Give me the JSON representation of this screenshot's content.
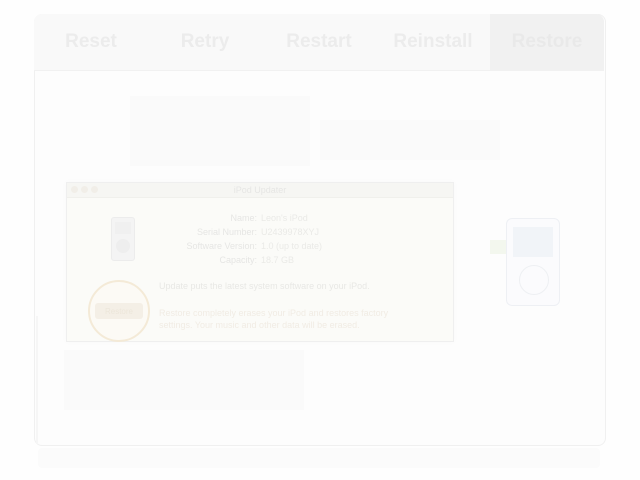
{
  "tabs": [
    {
      "label": "Reset",
      "active": false
    },
    {
      "label": "Retry",
      "active": false
    },
    {
      "label": "Restart",
      "active": false
    },
    {
      "label": "Reinstall",
      "active": false
    },
    {
      "label": "Restore",
      "active": true
    }
  ],
  "dialog": {
    "title": "iPod Updater",
    "info": [
      {
        "key": "Name:",
        "value": "Leon's iPod"
      },
      {
        "key": "Serial Number:",
        "value": "U2439978XYJ"
      },
      {
        "key": "Software Version:",
        "value": "1.0 (up to date)"
      },
      {
        "key": "Capacity:",
        "value": "18.7 GB"
      }
    ],
    "message_primary": "Update puts the latest system software on your iPod.",
    "message_secondary": "Restore completely erases your iPod and restores factory settings. Your music and other data will be erased.",
    "restore_button_label": "Restore"
  },
  "colors": {
    "tab_text": "#ececec",
    "accent_ring": "#f4ead7"
  }
}
